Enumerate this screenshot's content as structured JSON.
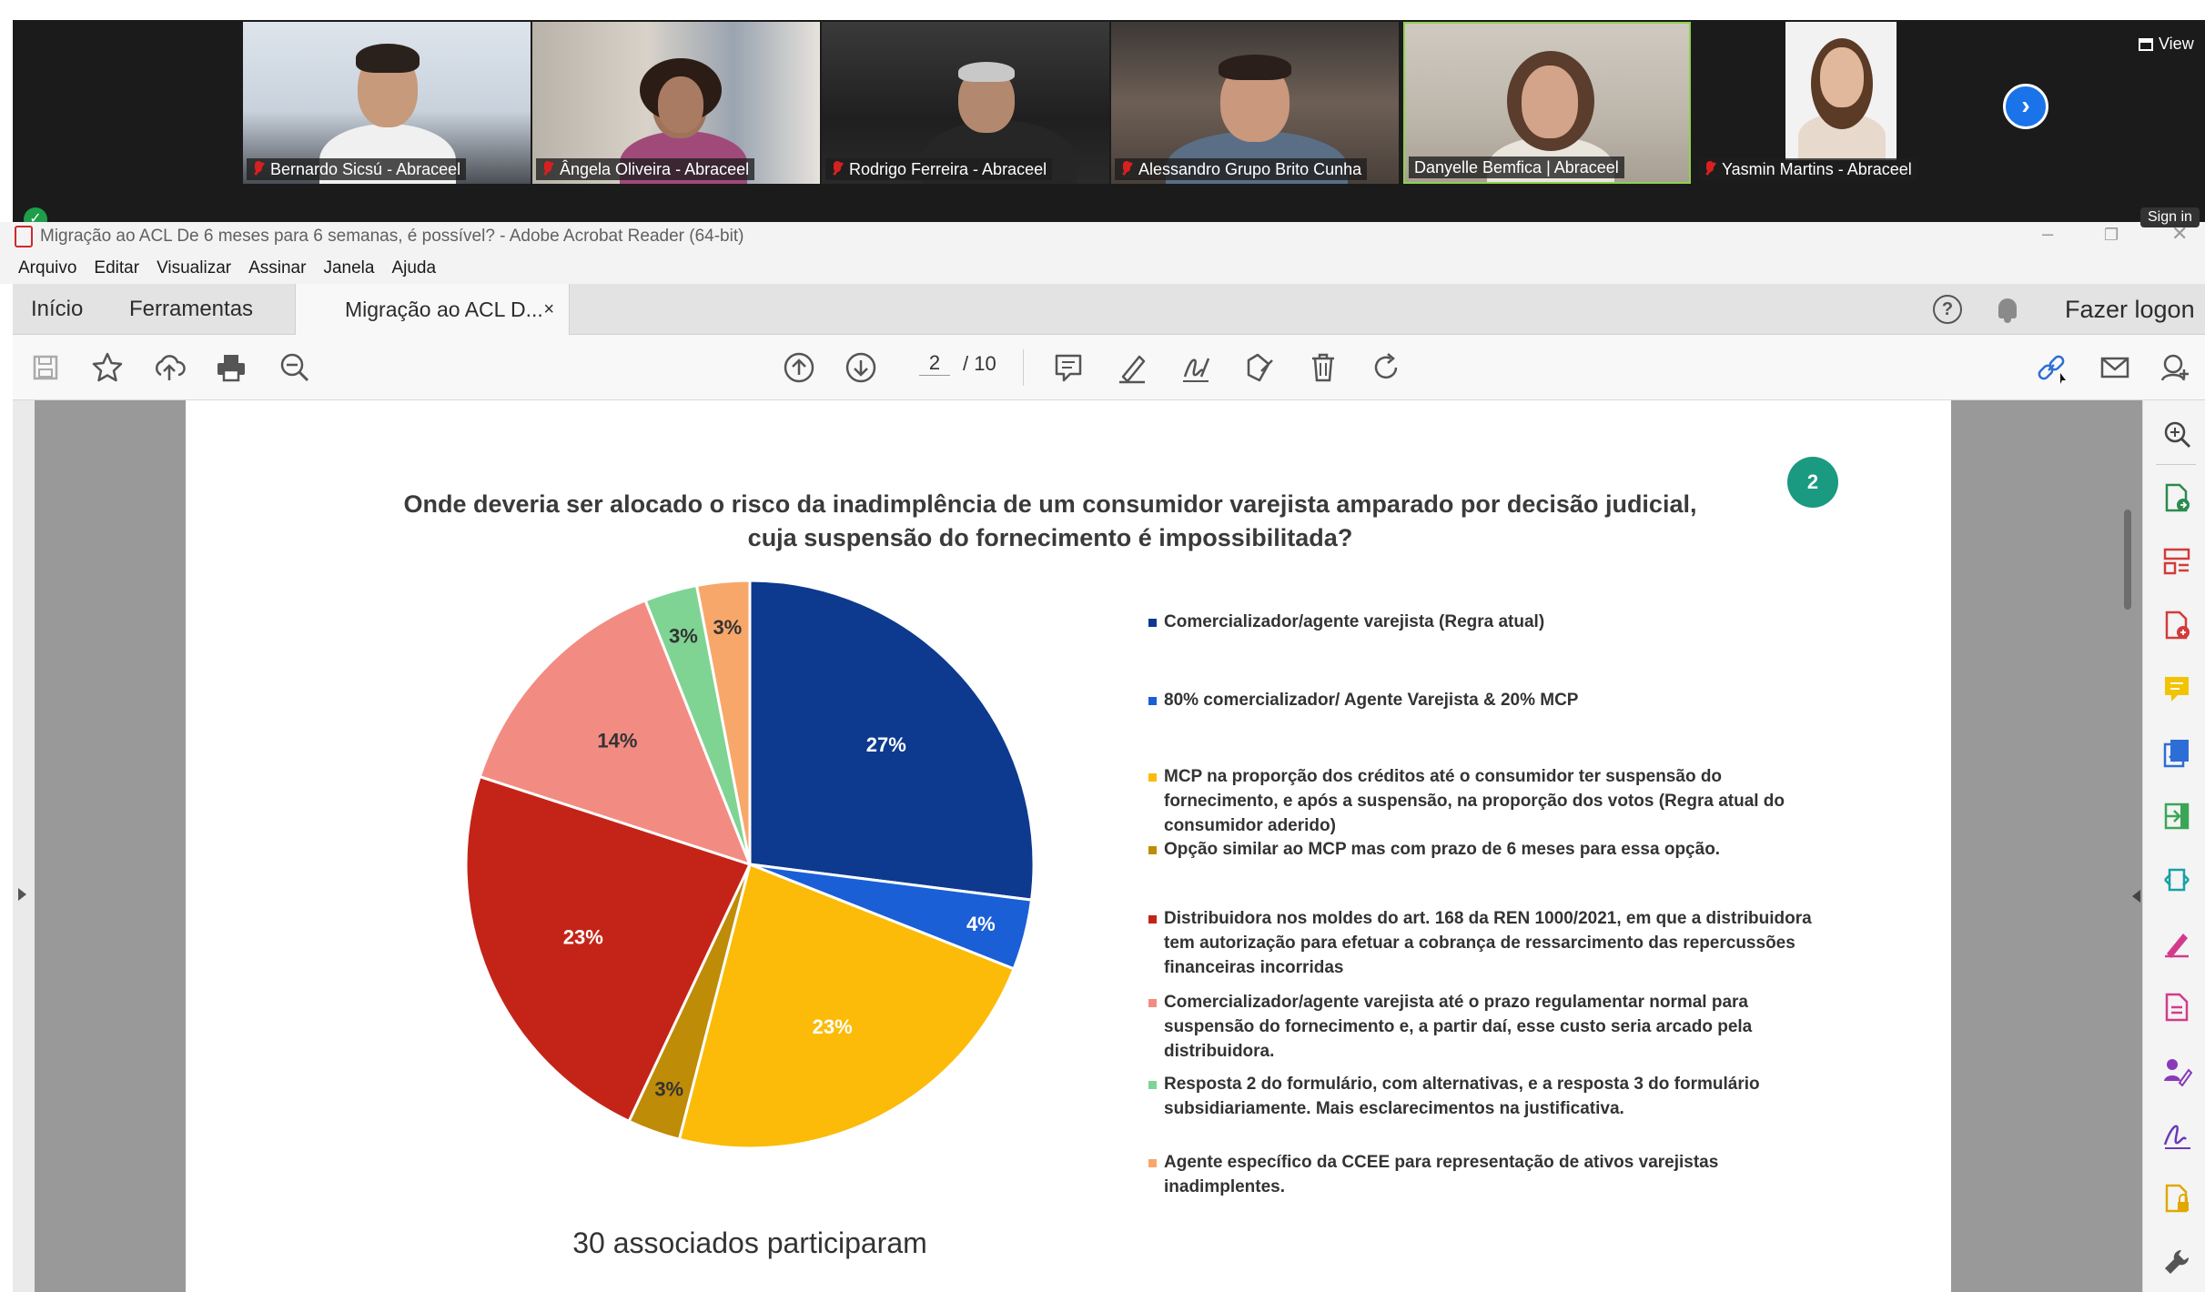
{
  "meeting": {
    "participants": [
      {
        "name": "Bernardo Sicsú - Abraceel",
        "muted": true
      },
      {
        "name": "Ângela Oliveira - Abraceel",
        "muted": true
      },
      {
        "name": "Rodrigo Ferreira - Abraceel",
        "muted": true
      },
      {
        "name": "Alessandro Grupo Brito Cunha",
        "muted": true
      },
      {
        "name": "Danyelle Bemfica | Abraceel",
        "muted": false
      },
      {
        "name": "Yasmin Martins - Abraceel",
        "muted": true
      }
    ],
    "view_label": "View",
    "sign_in_label": "Sign in"
  },
  "window": {
    "title": "Migração ao ACL De 6 meses para 6 semanas, é possível? - Adobe Acrobat Reader (64-bit)"
  },
  "menu": [
    "Arquivo",
    "Editar",
    "Visualizar",
    "Assinar",
    "Janela",
    "Ajuda"
  ],
  "tabs": {
    "home": "Início",
    "tools": "Ferramentas",
    "document": "Migração ao ACL D...",
    "close": "×",
    "logon": "Fazer logon"
  },
  "toolbar": {
    "current_page": "2",
    "total_pages": "/ 10"
  },
  "slide": {
    "number": "2",
    "title_line1": "Onde deveria ser alocado o risco da inadimplência de um consumidor varejista amparado por decisão judicial,",
    "title_line2": "cuja suspensão do fornecimento é impossibilitada?",
    "footer": "30 associados participaram"
  },
  "chart_data": {
    "type": "pie",
    "slices": [
      {
        "label": "Comercializador/agente varejista (Regra atual)",
        "value": 27,
        "display": "27%",
        "color": "#0d3a8e"
      },
      {
        "label": "80% comercializador/ Agente Varejista & 20% MCP",
        "value": 4,
        "display": "4%",
        "color": "#1a5fd6"
      },
      {
        "label": "MCP na proporção dos créditos até o consumidor ter suspensão do fornecimento, e após a suspensão, na proporção dos votos (Regra atual do consumidor aderido)",
        "value": 23,
        "display": "23%",
        "color": "#fbbb08"
      },
      {
        "label": "Opção similar ao MCP mas com prazo de 6 meses para essa opção.",
        "value": 3,
        "display": "3%",
        "color": "#bf8c08"
      },
      {
        "label": "Distribuidora nos moldes do art. 168 da REN 1000/2021, em que a distribuidora tem autorização para efetuar a cobrança de ressarcimento das repercussões financeiras incorridas",
        "value": 23,
        "display": "23%",
        "color": "#c42418"
      },
      {
        "label": "Comercializador/agente varejista até o prazo regulamentar normal para suspensão do fornecimento e, a partir daí, esse custo seria arcado pela distribuidora.",
        "value": 14,
        "display": "14%",
        "color": "#f28c82"
      },
      {
        "label": "Resposta 2 do formulário, com alternativas, e a resposta 3 do formulário subsidiariamente. Mais esclarecimentos na justificativa.",
        "value": 3,
        "display": "3%",
        "color": "#7fd494"
      },
      {
        "label": "Agente específico da CCEE para representação de ativos varejistas inadimplentes.",
        "value": 3,
        "display": "3%",
        "color": "#f8a76a"
      }
    ]
  }
}
